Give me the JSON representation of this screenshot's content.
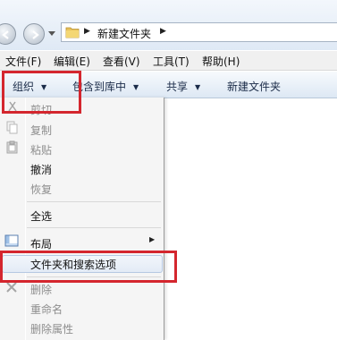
{
  "address": {
    "path_segment": "新建文件夹"
  },
  "menubar": {
    "items": [
      "文件(F)",
      "编辑(E)",
      "查看(V)",
      "工具(T)",
      "帮助(H)"
    ]
  },
  "toolbar": {
    "organize": "组织",
    "include_library": "包含到库中",
    "share": "共享",
    "new_folder": "新建文件夹"
  },
  "organize_menu": {
    "cut": "剪切",
    "copy": "复制",
    "paste": "粘贴",
    "undo": "撤消",
    "redo": "恢复",
    "select_all": "全选",
    "layout": "布局",
    "folder_options": "文件夹和搜索选项",
    "delete": "删除",
    "rename": "重命名",
    "delete_properties": "删除属性"
  },
  "colors": {
    "highlight_box": "#d4262e",
    "toolbar_text": "#1a2b48",
    "disabled_text": "#8d8d8d"
  }
}
